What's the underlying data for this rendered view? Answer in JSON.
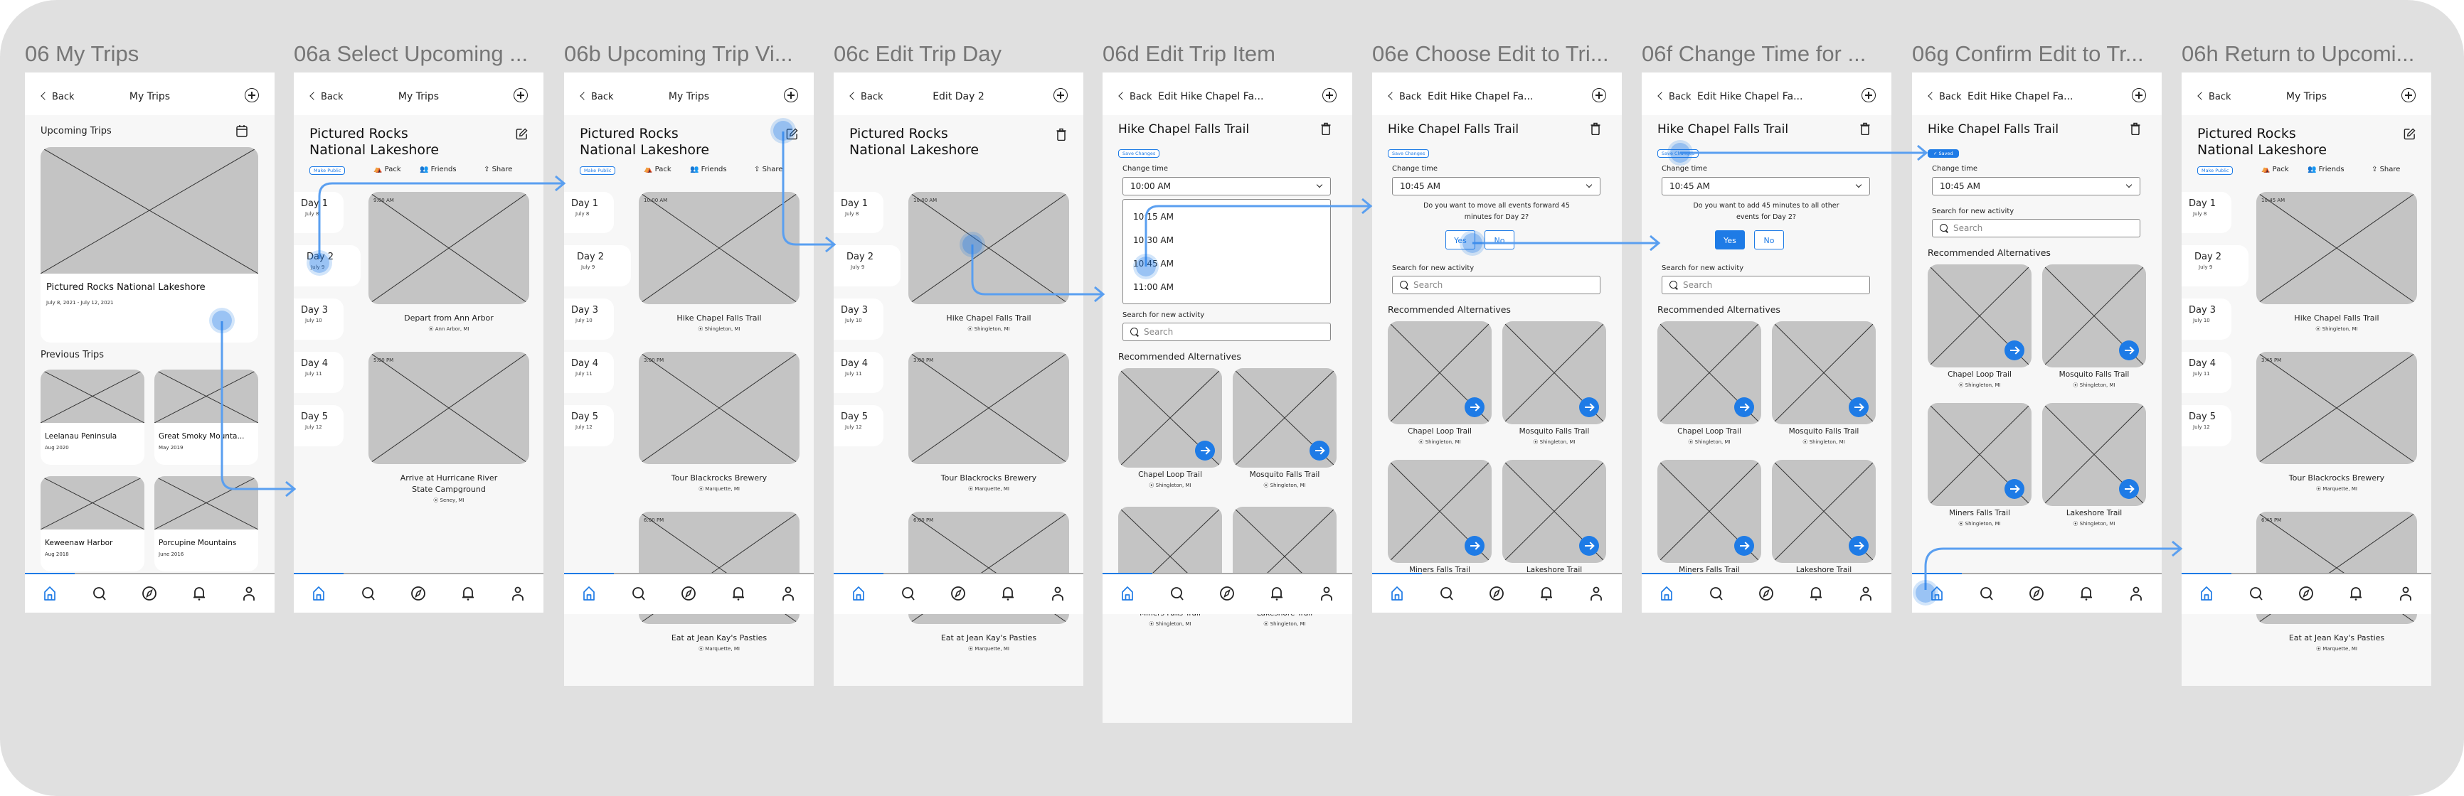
{
  "canvas": {
    "background": "#e0e0e0",
    "accent": "#1e7be6"
  },
  "common": {
    "back_label": "Back",
    "my_trips_title": "My Trips",
    "trip_name_line1": "Pictured Rocks",
    "trip_name_line2": "National Lakeshore",
    "make_public": "Make Public",
    "pack": "Pack",
    "friends": "Friends",
    "share": "Share",
    "save_changes": "Save Changes",
    "saved": "✓ Saved",
    "change_time_label": "Change time",
    "search_label": "Search for new activity",
    "search_placeholder": "Search",
    "recommended_title": "Recommended Alternatives",
    "item_title": "Hike Chapel Falls Trail",
    "edit_item_header": "Edit Hike Chapel Fa...",
    "nav_icons": [
      "home-icon",
      "search-icon",
      "compass-icon",
      "bell-icon",
      "profile-icon"
    ]
  },
  "days": [
    {
      "label": "Day 1",
      "date": "July 8"
    },
    {
      "label": "Day 2",
      "date": "July 9"
    },
    {
      "label": "Day 3",
      "date": "July 10"
    },
    {
      "label": "Day 4",
      "date": "July 11"
    },
    {
      "label": "Day 5",
      "date": "July 12"
    }
  ],
  "alternatives": [
    {
      "name": "Chapel Loop Trail",
      "location": "Shingleton, MI"
    },
    {
      "name": "Mosquito Falls Trail",
      "location": "Shingleton, MI"
    },
    {
      "name": "Miners Falls Trail",
      "location": "Shingleton, MI"
    },
    {
      "name": "Lakeshore Trail",
      "location": "Shingleton, MI"
    }
  ],
  "frames": [
    {
      "title": "06 My Trips",
      "upcoming_title": "Upcoming Trips",
      "upcoming_trip": {
        "name": "Pictured Rocks National Lakeshore",
        "dates": "July 8, 2021 - July 12, 2021"
      },
      "previous_title": "Previous Trips",
      "previous_trips": [
        {
          "name": "Leelanau Peninsula",
          "date": "Aug 2020"
        },
        {
          "name": "Great Smoky Mounta...",
          "date": "May 2019"
        },
        {
          "name": "Keweenaw Harbor",
          "date": "Aug 2018"
        },
        {
          "name": "Porcupine Mountains",
          "date": "June 2016"
        }
      ]
    },
    {
      "title": "06a Select Upcoming ...",
      "events": [
        {
          "time": "9:00 AM",
          "title": "Depart from Ann Arbor",
          "location": "Ann Arbor, MI"
        },
        {
          "time": "5:00 PM",
          "title": "Arrive at Hurricane River State Campground",
          "location": "Seney, MI"
        }
      ]
    },
    {
      "title": "06b Upcoming Trip Vi...",
      "events": [
        {
          "time": "10:00 AM",
          "title": "Hike Chapel Falls Trail",
          "location": "Shingleton, MI"
        },
        {
          "time": "3:00 PM",
          "title": "Tour Blackrocks Brewery",
          "location": "Marquette, MI"
        },
        {
          "time": "6:00 PM",
          "title": "Eat at Jean Kay's Pasties",
          "location": "Marquette, MI"
        }
      ]
    },
    {
      "title": "06c Edit Trip Day",
      "header": "Edit Day 2",
      "events": [
        {
          "time": "10:00 AM",
          "title": "Hike Chapel Falls Trail",
          "location": "Shingleton, MI"
        },
        {
          "time": "3:00 PM",
          "title": "Tour Blackrocks Brewery",
          "location": "Marquette, MI"
        },
        {
          "time": "6:00 PM",
          "title": "Eat at Jean Kay's Pasties",
          "location": "Marquette, MI"
        }
      ]
    },
    {
      "title": "06d Edit Trip Item",
      "time_value": "10:00 AM",
      "time_options": [
        "10:15 AM",
        "10:30 AM",
        "10:45 AM",
        "11:00 AM"
      ]
    },
    {
      "title": "06e Choose Edit to Tri...",
      "time_value": "10:45 AM",
      "question": "Do you want to move all events forward 45 minutes for Day 2?",
      "yes": "Yes",
      "no": "No"
    },
    {
      "title": "06f Change Time for ...",
      "time_value": "10:45 AM",
      "question": "Do you want to add 45 minutes to all other events for Day 2?",
      "yes": "Yes",
      "no": "No"
    },
    {
      "title": "06g Confirm Edit to Tr...",
      "time_value": "10:45 AM"
    },
    {
      "title": "06h Return to Upcomi...",
      "events": [
        {
          "time": "10:45 AM",
          "title": "Hike Chapel Falls Trail",
          "location": "Shingleton, MI"
        },
        {
          "time": "3:45 PM",
          "title": "Tour Blackrocks Brewery",
          "location": "Marquette, MI"
        },
        {
          "time": "6:45 PM",
          "title": "Eat at Jean Kay's Pasties",
          "location": "Marquette, MI"
        }
      ]
    }
  ]
}
